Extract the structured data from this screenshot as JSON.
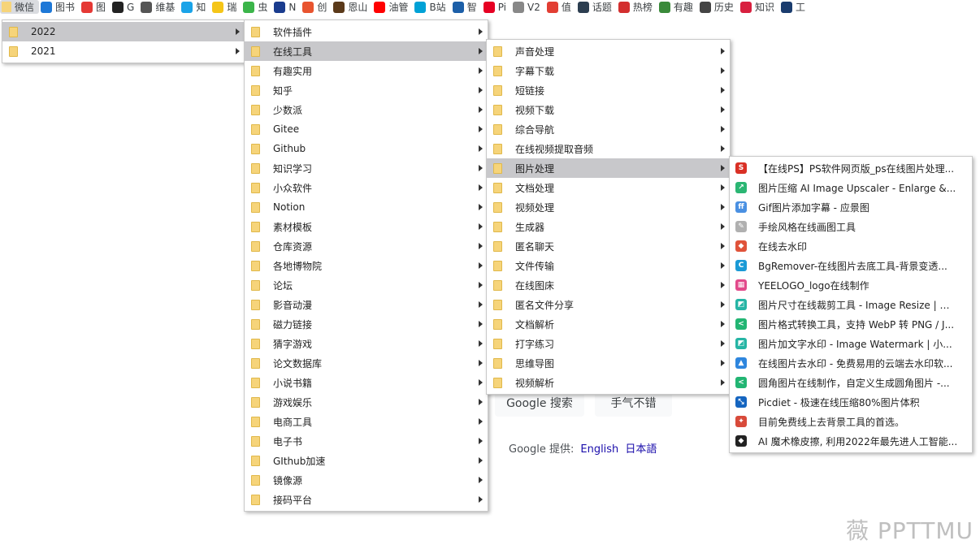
{
  "bookmarks": [
    {
      "label": "微信",
      "icon": "folder-icon",
      "color": "#f6d47a",
      "active": true
    },
    {
      "label": "图书",
      "icon": "ie-icon",
      "color": "#1e78d7"
    },
    {
      "label": "图",
      "icon": "image-icon",
      "color": "#e53935"
    },
    {
      "label": "G",
      "icon": "github-icon",
      "color": "#222222"
    },
    {
      "label": "维基",
      "icon": "wikipedia-icon",
      "color": "#555555"
    },
    {
      "label": "知",
      "icon": "zhi-icon",
      "color": "#1aa3e8"
    },
    {
      "label": "瑞",
      "icon": "star-icon",
      "color": "#f5c518"
    },
    {
      "label": "虫",
      "icon": "q-icon",
      "color": "#3bb54a"
    },
    {
      "label": "N",
      "icon": "n-icon",
      "color": "#1a3c8e"
    },
    {
      "label": "创",
      "icon": "c-icon",
      "color": "#e8542f"
    },
    {
      "label": "恩山",
      "icon": "enshan-icon",
      "color": "#5b3a1a"
    },
    {
      "label": "油管",
      "icon": "youtube-icon",
      "color": "#ff0000"
    },
    {
      "label": "B站",
      "icon": "bilibili-icon",
      "color": "#00a1d6"
    },
    {
      "label": "智",
      "icon": "info-icon",
      "color": "#1c5fa8"
    },
    {
      "label": "Pi",
      "icon": "pinterest-icon",
      "color": "#e60023"
    },
    {
      "label": "V2",
      "icon": "v2ex-icon",
      "color": "#888888"
    },
    {
      "label": "值",
      "icon": "smzdm-icon",
      "color": "#e23e33"
    },
    {
      "label": "话题",
      "icon": "r-icon",
      "color": "#2c3e50"
    },
    {
      "label": "热榜",
      "icon": "hot-icon",
      "color": "#d32f2f"
    },
    {
      "label": "有趣",
      "icon": "fun-icon",
      "color": "#3a8a3a"
    },
    {
      "label": "历史",
      "icon": "history-icon",
      "color": "#444444"
    },
    {
      "label": "知识",
      "icon": "knowledge-icon",
      "color": "#d8203f"
    },
    {
      "label": "工",
      "icon": "g-icon",
      "color": "#1a3c6e"
    }
  ],
  "menu_years": [
    {
      "label": "2022",
      "highlight": true
    },
    {
      "label": "2021",
      "highlight": false
    }
  ],
  "menu_categories": [
    {
      "label": "软件插件"
    },
    {
      "label": "在线工具",
      "highlight": true
    },
    {
      "label": "有趣实用"
    },
    {
      "label": "知乎"
    },
    {
      "label": "少数派"
    },
    {
      "label": "Gitee"
    },
    {
      "label": "Github"
    },
    {
      "label": "知识学习"
    },
    {
      "label": "小众软件"
    },
    {
      "label": "Notion"
    },
    {
      "label": "素材模板"
    },
    {
      "label": "仓库资源"
    },
    {
      "label": "各地博物院"
    },
    {
      "label": "论坛"
    },
    {
      "label": "影音动漫"
    },
    {
      "label": "磁力链接"
    },
    {
      "label": "猜字游戏"
    },
    {
      "label": "论文数据库"
    },
    {
      "label": "小说书籍"
    },
    {
      "label": "游戏娱乐"
    },
    {
      "label": "电商工具"
    },
    {
      "label": "电子书"
    },
    {
      "label": "GIthub加速"
    },
    {
      "label": "镜像源"
    },
    {
      "label": "接码平台"
    }
  ],
  "menu_tools": [
    {
      "label": "声音处理"
    },
    {
      "label": "字幕下载"
    },
    {
      "label": "短链接"
    },
    {
      "label": "视频下载"
    },
    {
      "label": "综合导航"
    },
    {
      "label": "在线视频提取音频"
    },
    {
      "label": "图片处理",
      "highlight": true
    },
    {
      "label": "文档处理"
    },
    {
      "label": "视频处理"
    },
    {
      "label": "生成器"
    },
    {
      "label": "匿名聊天"
    },
    {
      "label": "文件传输"
    },
    {
      "label": "在线图床"
    },
    {
      "label": "匿名文件分享"
    },
    {
      "label": "文档解析"
    },
    {
      "label": "打字练习"
    },
    {
      "label": "思维导图"
    },
    {
      "label": "视频解析"
    }
  ],
  "menu_image_tools": [
    {
      "label": "【在线PS】PS软件网页版_ps在线图片处理...",
      "icon": "photopea-icon",
      "color": "#d93025",
      "glyph": "S"
    },
    {
      "label": "图片压缩 AI Image Upscaler - Enlarge &...",
      "icon": "upscaler-icon",
      "color": "#2bb673",
      "glyph": "↗"
    },
    {
      "label": "Gif图片添加字幕 - 应景图",
      "icon": "gif-icon",
      "color": "#4a90e2",
      "glyph": "ff"
    },
    {
      "label": "手绘风格在线画图工具",
      "icon": "pen-icon",
      "color": "#b0b0b0",
      "glyph": "✎"
    },
    {
      "label": "在线去水印",
      "icon": "eraser-icon",
      "color": "#e0533a",
      "glyph": "◆"
    },
    {
      "label": "BgRemover-在线图片去底工具-背景变透...",
      "icon": "bgremover-icon",
      "color": "#1a9ad6",
      "glyph": "C"
    },
    {
      "label": "YEELOGO_logo在线制作",
      "icon": "yeelogo-icon",
      "color": "#e24a8b",
      "glyph": "▦"
    },
    {
      "label": "图片尺寸在线裁剪工具 - Image Resize | 小...",
      "icon": "resize-icon",
      "color": "#26b5a5",
      "glyph": "◩"
    },
    {
      "label": "图片格式转换工具，支持 WebP 转 PNG / J...",
      "icon": "convert-icon",
      "color": "#22b573",
      "glyph": "<"
    },
    {
      "label": "图片加文字水印 - Image Watermark | 小...",
      "icon": "watermark-icon",
      "color": "#26b5a5",
      "glyph": "◩"
    },
    {
      "label": "在线图片去水印 - 免费易用的云端去水印软...",
      "icon": "user-icon",
      "color": "#2e86de",
      "glyph": "▲"
    },
    {
      "label": "圆角图片在线制作，自定义生成圆角图片 -...",
      "icon": "rounded-icon",
      "color": "#22b573",
      "glyph": "<"
    },
    {
      "label": "Picdiet - 极速在线压缩80%图片体积",
      "icon": "picdiet-icon",
      "color": "#1565c0",
      "glyph": "⤡"
    },
    {
      "label": "目前免费线上去背景工具的首选。",
      "icon": "removebg-icon",
      "color": "#d84a3a",
      "glyph": "✦"
    },
    {
      "label": "AI 魔术橡皮擦, 利用2022年最先进人工智能...",
      "icon": "magic-eraser-icon",
      "color": "#222222",
      "glyph": "◆"
    }
  ],
  "google": {
    "search_button": "Google 搜索",
    "lucky_button": "手气不错",
    "offered_in": "Google 提供:",
    "lang_english": "English",
    "lang_japanese": "日本語"
  },
  "watermark": "薇 PPTTMU"
}
